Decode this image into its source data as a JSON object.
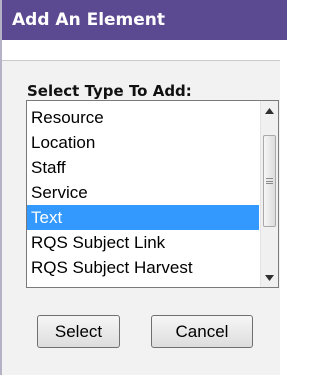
{
  "dialog": {
    "title": "Add An Element"
  },
  "type_list": {
    "label": "Select Type To Add:",
    "options": [
      "Resource",
      "Location",
      "Staff",
      "Service",
      "Text",
      "RQS Subject Link",
      "RQS Subject Harvest"
    ],
    "selected": "Text"
  },
  "buttons": {
    "select_label": "Select",
    "cancel_label": "Cancel"
  },
  "colors": {
    "title_bar": "#5b4a91",
    "selection": "#3399ff",
    "panel_background": "#f2f2f2"
  },
  "icons": {
    "scroll_up": "triangle-up",
    "scroll_down": "triangle-down"
  }
}
